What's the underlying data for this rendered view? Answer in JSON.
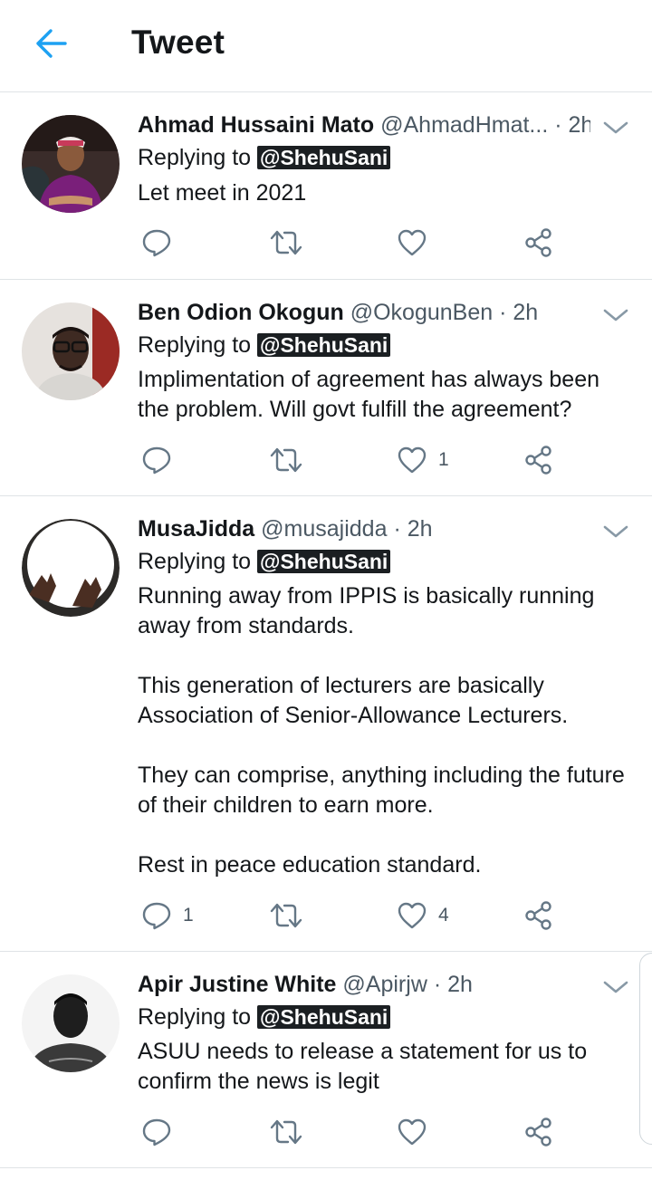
{
  "header": {
    "title": "Tweet"
  },
  "tweets": [
    {
      "name": "Ahmad Hussaini Mato",
      "handle": "@AhmadHmat...",
      "time": "2h",
      "replying_label": "Replying to",
      "replying_to": "@ShehuSani",
      "text": "Let meet in 2021",
      "replies": "",
      "likes": ""
    },
    {
      "name": "Ben Odion Okogun",
      "handle": "@OkogunBen",
      "time": "2h",
      "replying_label": "Replying to",
      "replying_to": "@ShehuSani",
      "text": "Implimentation of agreement has always been the problem. Will govt fulfill the agreement?",
      "replies": "",
      "likes": "1"
    },
    {
      "name": "MusaJidda",
      "handle": "@musajidda",
      "time": "2h",
      "replying_label": "Replying to",
      "replying_to": "@ShehuSani",
      "text": "Running away from IPPIS is basically running away from standards.\n\nThis generation of lecturers are basically Association of Senior-Allowance Lecturers.\n\nThey can comprise, anything including the future of their children to earn more.\n\nRest in peace education standard.",
      "replies": "1",
      "likes": "4"
    },
    {
      "name": "Apir Justine White",
      "handle": "@Apirjw",
      "time": "2h",
      "replying_label": "Replying to",
      "replying_to": "@ShehuSani",
      "text": "ASUU needs to release a statement for us to confirm the news is legit",
      "replies": "",
      "likes": ""
    }
  ],
  "icons": {
    "back": "arrow-left-icon",
    "reply": "reply-icon",
    "retweet": "retweet-icon",
    "like": "heart-icon",
    "share": "share-icon",
    "caret": "chevron-down-icon"
  },
  "colors": {
    "accent": "#1da1f2",
    "icon_gray": "#657786",
    "divider": "#dfe3e6"
  }
}
